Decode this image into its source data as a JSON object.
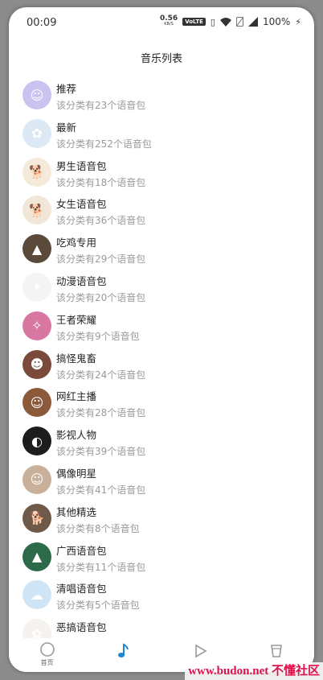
{
  "status_bar": {
    "time": "00:09",
    "net_speed_value": "0.56",
    "net_speed_unit": "KB/S",
    "volte": "VoLTE",
    "battery": "100%"
  },
  "header": {
    "title": "音乐列表"
  },
  "categories": [
    {
      "name": "推荐",
      "desc": "该分类有23个语音包",
      "avatar": "cartoon-boy",
      "color": "#c9c3f0"
    },
    {
      "name": "最新",
      "desc": "该分类有252个语音包",
      "avatar": "anime-girl",
      "color": "#dce8f3"
    },
    {
      "name": "男生语音包",
      "desc": "该分类有18个语音包",
      "avatar": "doge",
      "color": "#f3ead9"
    },
    {
      "name": "女生语音包",
      "desc": "该分类有36个语音包",
      "avatar": "doge",
      "color": "#f1e7d8"
    },
    {
      "name": "吃鸡专用",
      "desc": "该分类有29个语音包",
      "avatar": "game-scene",
      "color": "#5b4a3a"
    },
    {
      "name": "动漫语音包",
      "desc": "该分类有20个语音包",
      "avatar": "penguin",
      "color": "#f4f4f4"
    },
    {
      "name": "王者荣耀",
      "desc": "该分类有9个语音包",
      "avatar": "hero",
      "color": "#d977a3"
    },
    {
      "name": "搞怪鬼畜",
      "desc": "该分类有24个语音包",
      "avatar": "face",
      "color": "#7a4a3a"
    },
    {
      "name": "网红主播",
      "desc": "该分类有28个语音包",
      "avatar": "streamer",
      "color": "#8a5a3a"
    },
    {
      "name": "影视人物",
      "desc": "该分类有39个语音包",
      "avatar": "mask",
      "color": "#1d1d1d"
    },
    {
      "name": "偶像明星",
      "desc": "该分类有41个语音包",
      "avatar": "idol",
      "color": "#c9b09a"
    },
    {
      "name": "其他精选",
      "desc": "该分类有8个语音包",
      "avatar": "dog",
      "color": "#6f5a4a"
    },
    {
      "name": "广西语音包",
      "desc": "该分类有11个语音包",
      "avatar": "landscape",
      "color": "#2d6a4a"
    },
    {
      "name": "清唱语音包",
      "desc": "该分类有5个语音包",
      "avatar": "cloud-cat",
      "color": "#cfe4f4"
    },
    {
      "name": "恶搞语音包",
      "desc": "",
      "avatar": "rabbit",
      "color": "#f6f2ee"
    }
  ],
  "bottom_nav": {
    "home_label": "首页",
    "music_color": "#1f86d6",
    "inactive_color": "#9a9a9a"
  },
  "watermark": "www.budon.net 不懂社区"
}
